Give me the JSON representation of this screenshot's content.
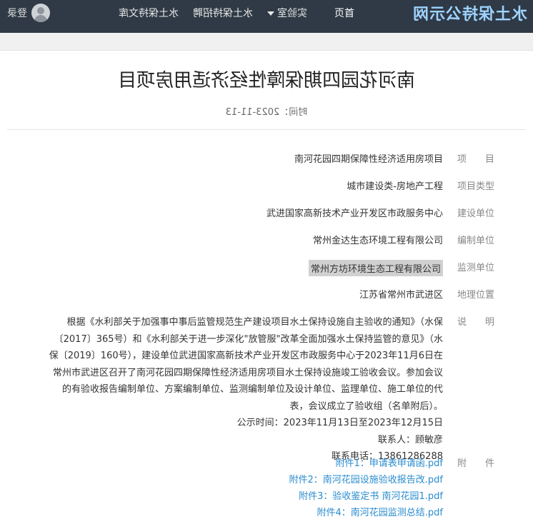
{
  "site": {
    "logo_text": "水土保持公示网"
  },
  "nav": {
    "items": [
      {
        "label": "首页"
      },
      {
        "label": "实验室"
      },
      {
        "label": "水土保持招聘"
      },
      {
        "label": "水土保持文库"
      }
    ],
    "login_label": "登录"
  },
  "article": {
    "title": "南河花园四期保障性经济适用房项目",
    "date_label": "时间：2023-11-13"
  },
  "fields": [
    {
      "key": "项　　目",
      "value": "南河花园四期保障性经济适用房项目"
    },
    {
      "key": "项目类型",
      "value": "城市建设类-房地产工程"
    },
    {
      "key": "建设单位",
      "value": "武进国家高新技术产业开发区市政服务中心"
    },
    {
      "key": "编制单位",
      "value": "常州金达生态环境工程有限公司"
    },
    {
      "key": "监测单位",
      "value": "常州方坊环境生态工程有限公司"
    },
    {
      "key": "地理位置",
      "value": "江苏省常州市武进区"
    }
  ],
  "description": {
    "key": "说　　明",
    "lines": [
      "根据《水利部关于加强事中事后监管规范生产建设项目水土保持设施自主验收的通知》（水保",
      "〔2017〕365号）和《水利部关于进一步深化\"放管服\"改革全面加强水土保持监管的意见》（水",
      "保〔2019〕160号），建设单位武进国家高新技术产业开发区市政服务中心于2023年11月6日在",
      "常州市武进区召开了南河花园四期保障性经济适用房项目水土保持设施竣工验收会议。参加会议",
      "的有验收报告编制单位、方案编制单位、监测编制单位及设计单位、监理单位、施工单位的代",
      "表，会议成立了验收组（名单附后）。",
      "公示时间：2023年11月13日至2023年12月15日",
      "联系人：顾敏彦",
      "联系电话：13861286288"
    ]
  },
  "attachments": {
    "key": "附　　件",
    "items": [
      "附件1：申请表申请函.pdf",
      "附件2：南河花园设施验收报告改.pdf",
      "附件3：验收鉴定书 南河花园1.pdf",
      "附件4：南河花园监测总结.pdf"
    ]
  }
}
